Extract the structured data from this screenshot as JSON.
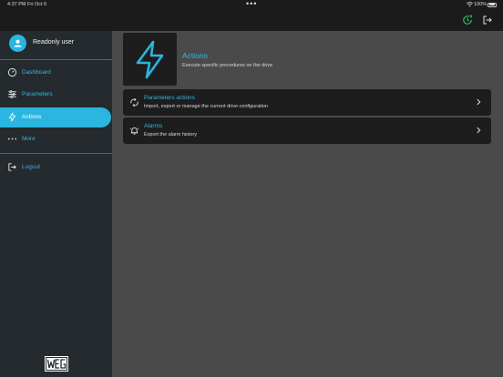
{
  "status_bar": {
    "time": "4:37 PM",
    "date": "Fri Oct 6",
    "battery": "100%"
  },
  "sidebar": {
    "user_name": "Readonly user",
    "items": [
      {
        "label": "Dashboard",
        "icon": "dashboard-gauge-icon"
      },
      {
        "label": "Parameters",
        "icon": "sliders-icon"
      },
      {
        "label": "Actions",
        "icon": "lightning-icon",
        "active": true
      },
      {
        "label": "More",
        "icon": "more-dots-icon"
      }
    ],
    "logout_label": "Logout",
    "logo_text": "WEG"
  },
  "main": {
    "title": "Actions",
    "subtitle": "Execute specific procedures on the drive",
    "cards": [
      {
        "title": "Parameters actions",
        "description": "Import, export or manage the current drive configuration",
        "icon": "parameters-sync-icon"
      },
      {
        "title": "Alarms",
        "description": "Export the alarm history",
        "icon": "alarm-bell-icon"
      }
    ]
  },
  "colors": {
    "accent": "#2ab6e0",
    "sidebar_bg": "#242a2d",
    "main_bg": "#4a4a4a",
    "card_bg": "#1d1d1d"
  }
}
